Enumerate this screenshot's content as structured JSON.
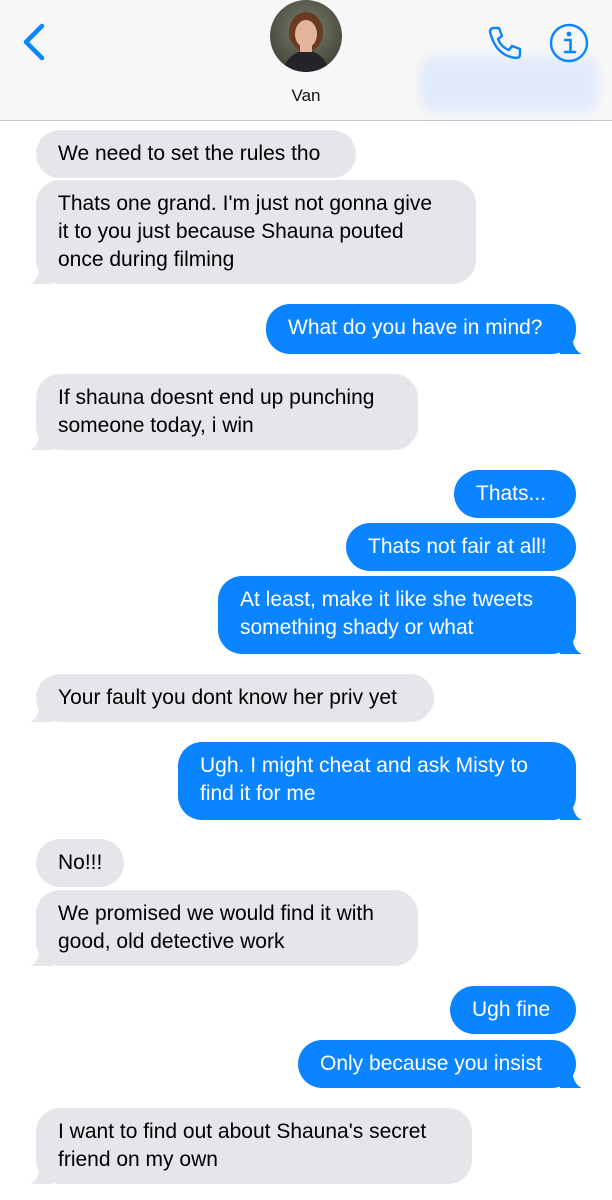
{
  "header": {
    "contact_name": "Van"
  },
  "colors": {
    "accent": "#0b84ff",
    "received_bubble": "#e5e5ea",
    "sent_bubble": "#0b84ff",
    "header_bg": "#f7f7f7"
  },
  "icons": {
    "back": "chevron-left-icon",
    "call": "phone-icon",
    "info": "info-icon"
  },
  "messages": [
    {
      "from": "received",
      "lines": [
        "We need to set the rules tho"
      ]
    },
    {
      "from": "received",
      "lines": [
        "Thats one grand. I'm just not gonna give",
        "it to you just because Shauna pouted",
        "once during filming"
      ]
    },
    {
      "from": "sent",
      "lines": [
        "What do you have in mind?"
      ]
    },
    {
      "from": "received",
      "lines": [
        "If shauna doesnt end up punching",
        "someone today, i win"
      ]
    },
    {
      "from": "sent",
      "lines": [
        "Thats..."
      ]
    },
    {
      "from": "sent",
      "lines": [
        "Thats not fair at all!"
      ]
    },
    {
      "from": "sent",
      "lines": [
        "At least, make it like she tweets",
        "something shady or what"
      ]
    },
    {
      "from": "received",
      "lines": [
        "Your fault you dont know her priv yet"
      ]
    },
    {
      "from": "sent",
      "lines": [
        "Ugh. I might cheat and ask Misty to",
        "find it for me"
      ]
    },
    {
      "from": "received",
      "lines": [
        "No!!!"
      ]
    },
    {
      "from": "received",
      "lines": [
        "We promised we would find it with",
        "good, old detective work"
      ]
    },
    {
      "from": "sent",
      "lines": [
        "Ugh fine"
      ]
    },
    {
      "from": "sent",
      "lines": [
        "Only because you insist"
      ]
    },
    {
      "from": "received",
      "lines": [
        "I want to find out about Shauna's secret",
        "friend on my own"
      ]
    }
  ]
}
